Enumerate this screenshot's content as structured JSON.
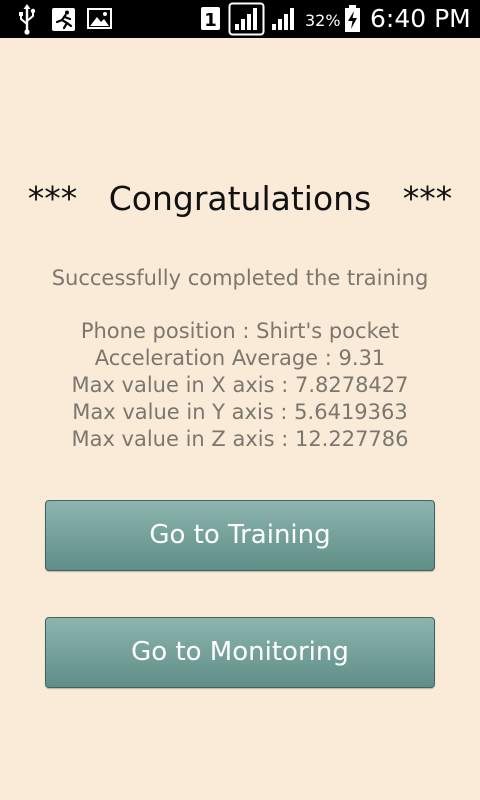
{
  "status_bar": {
    "icons_left": [
      "usb-icon",
      "app-notification-icon",
      "image-icon"
    ],
    "icons_right": [
      "sim-1-icon",
      "signal-sim1-icon",
      "signal-sim2-icon",
      "battery-charging-icon"
    ],
    "battery_percent": "32%",
    "time": "6:40 PM"
  },
  "result": {
    "title": "***   Congratulations   ***",
    "subtitle": "Successfully completed the training",
    "phone_position": "Phone position : Shirt's pocket",
    "acceleration_average": "Acceleration Average : 9.31",
    "max_x": "Max value in X axis : 7.8278427",
    "max_y": "Max value in Y axis : 5.6419363",
    "max_z": "Max value in Z axis : 12.227786"
  },
  "buttons": {
    "training": "Go to Training",
    "monitoring": "Go to Monitoring"
  },
  "colors": {
    "background": "#faebd9",
    "button": "#73a099",
    "button_border": "#3f6560",
    "status_bar": "#000000",
    "secondary_text": "#7b776f"
  }
}
